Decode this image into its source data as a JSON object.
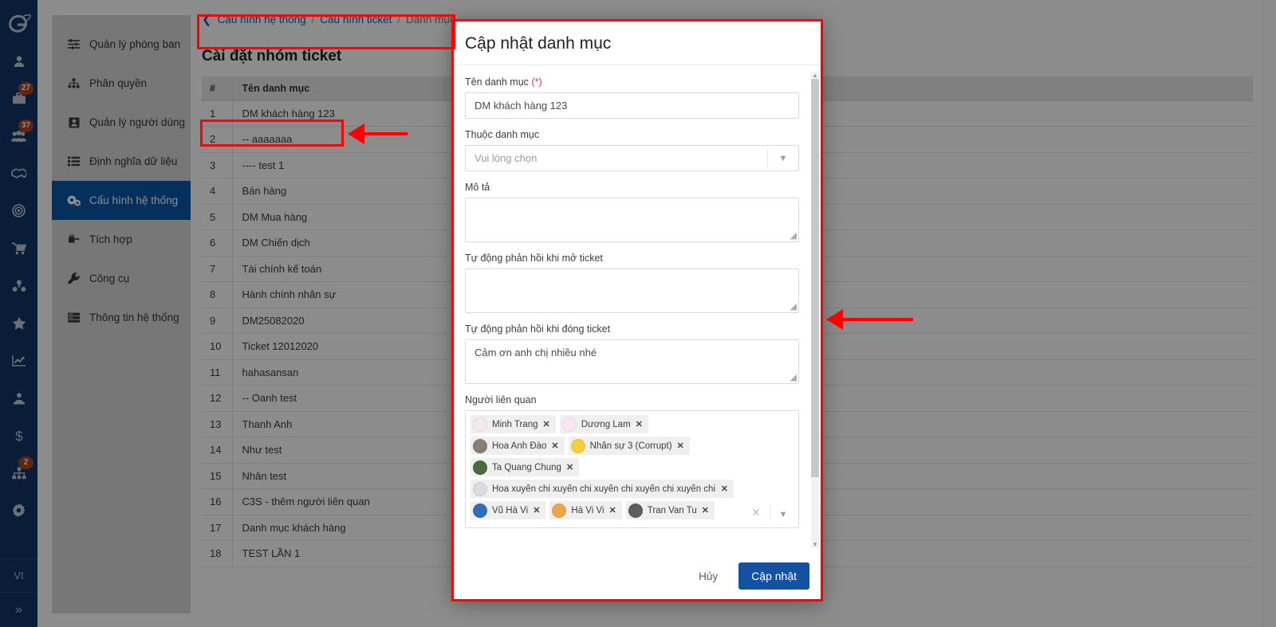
{
  "rail": {
    "logo_name": "app-logo",
    "items": [
      {
        "name": "user-icon",
        "badge": null
      },
      {
        "name": "briefcase-icon",
        "badge": "27"
      },
      {
        "name": "users-group-icon",
        "badge": "37"
      },
      {
        "name": "handshake-icon",
        "badge": null
      },
      {
        "name": "target-icon",
        "badge": null
      },
      {
        "name": "cart-icon",
        "badge": null
      },
      {
        "name": "boxes-icon",
        "badge": null
      },
      {
        "name": "star-icon",
        "badge": null
      },
      {
        "name": "chart-line-icon",
        "badge": null
      },
      {
        "name": "contact-icon",
        "badge": null
      },
      {
        "name": "dollar-icon",
        "badge": null
      },
      {
        "name": "sitemap-icon",
        "badge": "2"
      },
      {
        "name": "gear-icon",
        "badge": null
      }
    ],
    "language": "VI",
    "expand_label": "»"
  },
  "nav": {
    "items": [
      {
        "label": "Quản lý phòng ban",
        "icon": "sliders-icon",
        "active": false
      },
      {
        "label": "Phân quyền",
        "icon": "sitemap-icon",
        "active": false
      },
      {
        "label": "Quản lý người dùng",
        "icon": "id-card-icon",
        "active": false
      },
      {
        "label": "Định nghĩa dữ liệu",
        "icon": "list-icon",
        "active": false
      },
      {
        "label": "Cấu hình hệ thống",
        "icon": "cogs-icon",
        "active": true
      },
      {
        "label": "Tích hợp",
        "icon": "plug-icon",
        "active": false
      },
      {
        "label": "Công cụ",
        "icon": "wrench-icon",
        "active": false
      },
      {
        "label": "Thông tin hệ thống",
        "icon": "server-icon",
        "active": false
      }
    ]
  },
  "breadcrumb": {
    "back_icon": "chevron-left-icon",
    "items": [
      "Cấu hình hệ thống",
      "Cấu hình ticket",
      "Danh mục"
    ],
    "separator": "/"
  },
  "page": {
    "title": "Cài đặt nhóm ticket"
  },
  "table": {
    "columns": [
      "#",
      "Tên danh mục"
    ],
    "rows": [
      {
        "idx": "1",
        "name": "DM khách hàng 123"
      },
      {
        "idx": "2",
        "name": "-- aaaaaaa"
      },
      {
        "idx": "3",
        "name": "---- test 1"
      },
      {
        "idx": "4",
        "name": "Bán hàng"
      },
      {
        "idx": "5",
        "name": "DM Mua hàng"
      },
      {
        "idx": "6",
        "name": "DM Chiến dịch"
      },
      {
        "idx": "7",
        "name": "Tài chính kế toán"
      },
      {
        "idx": "8",
        "name": "Hành chính nhân sự"
      },
      {
        "idx": "9",
        "name": "DM25082020"
      },
      {
        "idx": "10",
        "name": "Ticket 12012020"
      },
      {
        "idx": "11",
        "name": "hahasansan"
      },
      {
        "idx": "12",
        "name": "-- Oanh test"
      },
      {
        "idx": "13",
        "name": "Thanh Anh"
      },
      {
        "idx": "14",
        "name": "Như test"
      },
      {
        "idx": "15",
        "name": "Nhân test"
      },
      {
        "idx": "16",
        "name": "C3S - thêm người liên quan"
      },
      {
        "idx": "17",
        "name": "Danh mục khách hàng"
      },
      {
        "idx": "18",
        "name": "TEST LẦN 1"
      }
    ]
  },
  "modal": {
    "title": "Cập nhật danh mục",
    "fields": {
      "name": {
        "label": "Tên danh mục",
        "required_mark": "(*)",
        "value": "DM khách hàng 123"
      },
      "parent": {
        "label": "Thuộc danh mục",
        "placeholder": "Vui lòng chọn",
        "value": "",
        "caret_icon": "chevron-down-icon"
      },
      "description": {
        "label": "Mô tả",
        "value": ""
      },
      "auto_reply_open": {
        "label": "Tự động phản hồi khi mở ticket",
        "value": ""
      },
      "auto_reply_close": {
        "label": "Tự động phản hồi khi đóng ticket",
        "value": "Cảm ơn anh chị nhiều nhé"
      },
      "related_people": {
        "label": "Người liên quan",
        "clear_icon": "clear-icon",
        "caret_icon": "chevron-down-icon",
        "remove_label": "✕",
        "tags": [
          {
            "name": "Minh Trang",
            "avatar": "#f5e7ea"
          },
          {
            "name": "Dương Lam",
            "avatar": "#fbe6ef"
          },
          {
            "name": "Hoa Anh Đào",
            "avatar": "#8a7e72"
          },
          {
            "name": "Nhân sự 3 (Corrupt)",
            "avatar": "#f6cf3f"
          },
          {
            "name": "Ta Quang Chung",
            "avatar": "#4b6b3c"
          },
          {
            "name": "Hoa xuyến chi xuyến chi xuyến chi xuyến chi xuyến chi xu",
            "avatar": "#d9dde2"
          },
          {
            "name": "Vũ Hà Vi",
            "avatar": "#2f6fb5"
          },
          {
            "name": "Hà Vi Vi",
            "avatar": "#e9a74a"
          },
          {
            "name": "Tran Van Tu",
            "avatar": "#5d5d5d"
          }
        ]
      }
    },
    "footer": {
      "cancel_label": "Hủy",
      "submit_label": "Cập nhật",
      "submit_color": "#1352a3"
    }
  },
  "annotations": {
    "color": "#ff0000",
    "boxes": [
      "breadcrumb-highlight",
      "row-1-highlight",
      "modal-highlight"
    ],
    "arrows": [
      "arrow-to-row-1",
      "arrow-to-modal-scrollbar"
    ]
  }
}
